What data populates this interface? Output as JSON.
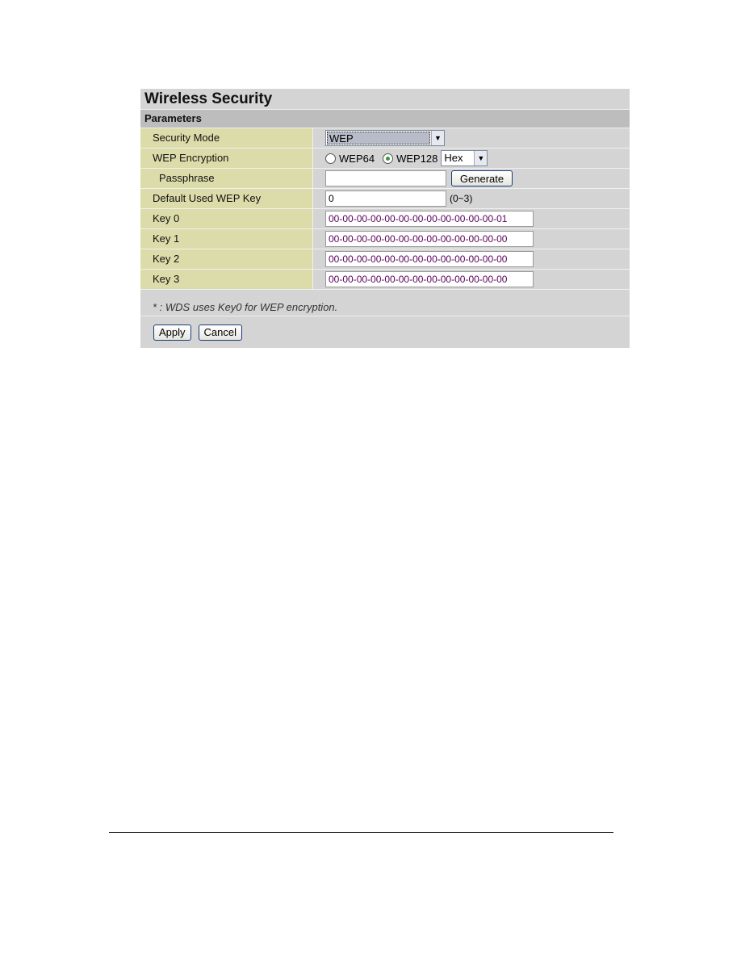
{
  "title": "Wireless Security",
  "section": "Parameters",
  "security_mode": {
    "label": "Security Mode",
    "value": "WEP"
  },
  "wep_encryption": {
    "label": "WEP Encryption",
    "options": [
      "WEP64",
      "WEP128"
    ],
    "selected": "WEP128",
    "format": "Hex"
  },
  "passphrase": {
    "label": "Passphrase",
    "value": "",
    "generate_label": "Generate"
  },
  "default_key": {
    "label": "Default Used WEP Key",
    "value": "0",
    "hint": "(0~3)"
  },
  "keys": [
    {
      "label": "Key 0",
      "value": "00-00-00-00-00-00-00-00-00-00-00-00-01"
    },
    {
      "label": "Key 1",
      "value": "00-00-00-00-00-00-00-00-00-00-00-00-00"
    },
    {
      "label": "Key 2",
      "value": "00-00-00-00-00-00-00-00-00-00-00-00-00"
    },
    {
      "label": "Key 3",
      "value": "00-00-00-00-00-00-00-00-00-00-00-00-00"
    }
  ],
  "note": "* : WDS uses Key0 for WEP encryption.",
  "apply_label": "Apply",
  "cancel_label": "Cancel"
}
